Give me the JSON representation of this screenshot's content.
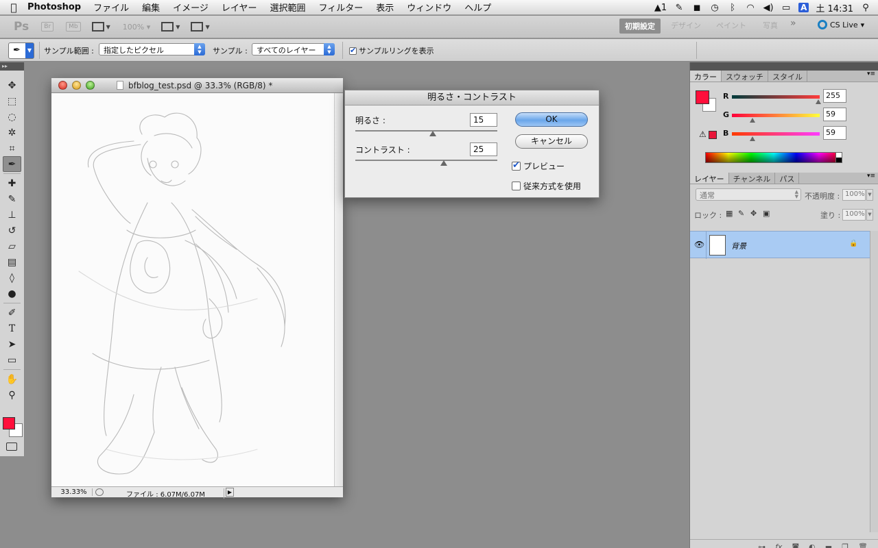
{
  "menubar": {
    "app_name": "Photoshop",
    "menus": [
      "ファイル",
      "編集",
      "イメージ",
      "レイヤー",
      "選択範囲",
      "フィルター",
      "表示",
      "ウィンドウ",
      "ヘルプ"
    ],
    "status": {
      "adobe_count": "1",
      "ime": "A",
      "clock": "土 14:31"
    }
  },
  "appbar": {
    "ps_logo": "Ps",
    "bridge": "Br",
    "minibridge": "Mb",
    "zoom": "100%",
    "workspaces": [
      "初期設定",
      "デザイン",
      "ペイント",
      "写真"
    ],
    "more": "»",
    "cslive": "CS Live"
  },
  "optionsbar": {
    "sample_size_label": "サンプル範囲 :",
    "sample_size_value": "指定したピクセル",
    "sample_label": "サンプル :",
    "sample_value": "すべてのレイヤー",
    "show_ring_label": "サンプルリングを表示",
    "show_ring_checked": true
  },
  "document": {
    "title": "bfblog_test.psd @ 33.3% (RGB/8) *",
    "zoom": "33.33%",
    "file_info": "ファイル : 6.07M/6.07M"
  },
  "dialog": {
    "title": "明るさ・コントラスト",
    "brightness_label": "明るさ :",
    "brightness_value": "15",
    "contrast_label": "コントラスト :",
    "contrast_value": "25",
    "ok_label": "OK",
    "cancel_label": "キャンセル",
    "preview_label": "プレビュー",
    "preview_checked": true,
    "legacy_label": "従来方式を使用",
    "legacy_checked": false
  },
  "color_panel": {
    "tabs": [
      "カラー",
      "スウォッチ",
      "スタイル"
    ],
    "r_label": "R",
    "r_value": "255",
    "g_label": "G",
    "g_value": "59",
    "b_label": "B",
    "b_value": "59",
    "foreground_color": "#ff0f3b",
    "background_color": "#ffffff"
  },
  "layers_panel": {
    "tabs": [
      "レイヤー",
      "チャンネル",
      "パス"
    ],
    "blend_mode": "通常",
    "opacity_label": "不透明度 :",
    "opacity_value": "100%",
    "lock_label": "ロック :",
    "fill_label": "塗り :",
    "fill_value": "100%",
    "layer_name": "背景"
  },
  "footer_icons": [
    "link-icon",
    "fx-icon",
    "mask-icon",
    "adjustment-icon",
    "group-icon",
    "new-layer-icon",
    "trash-icon"
  ]
}
